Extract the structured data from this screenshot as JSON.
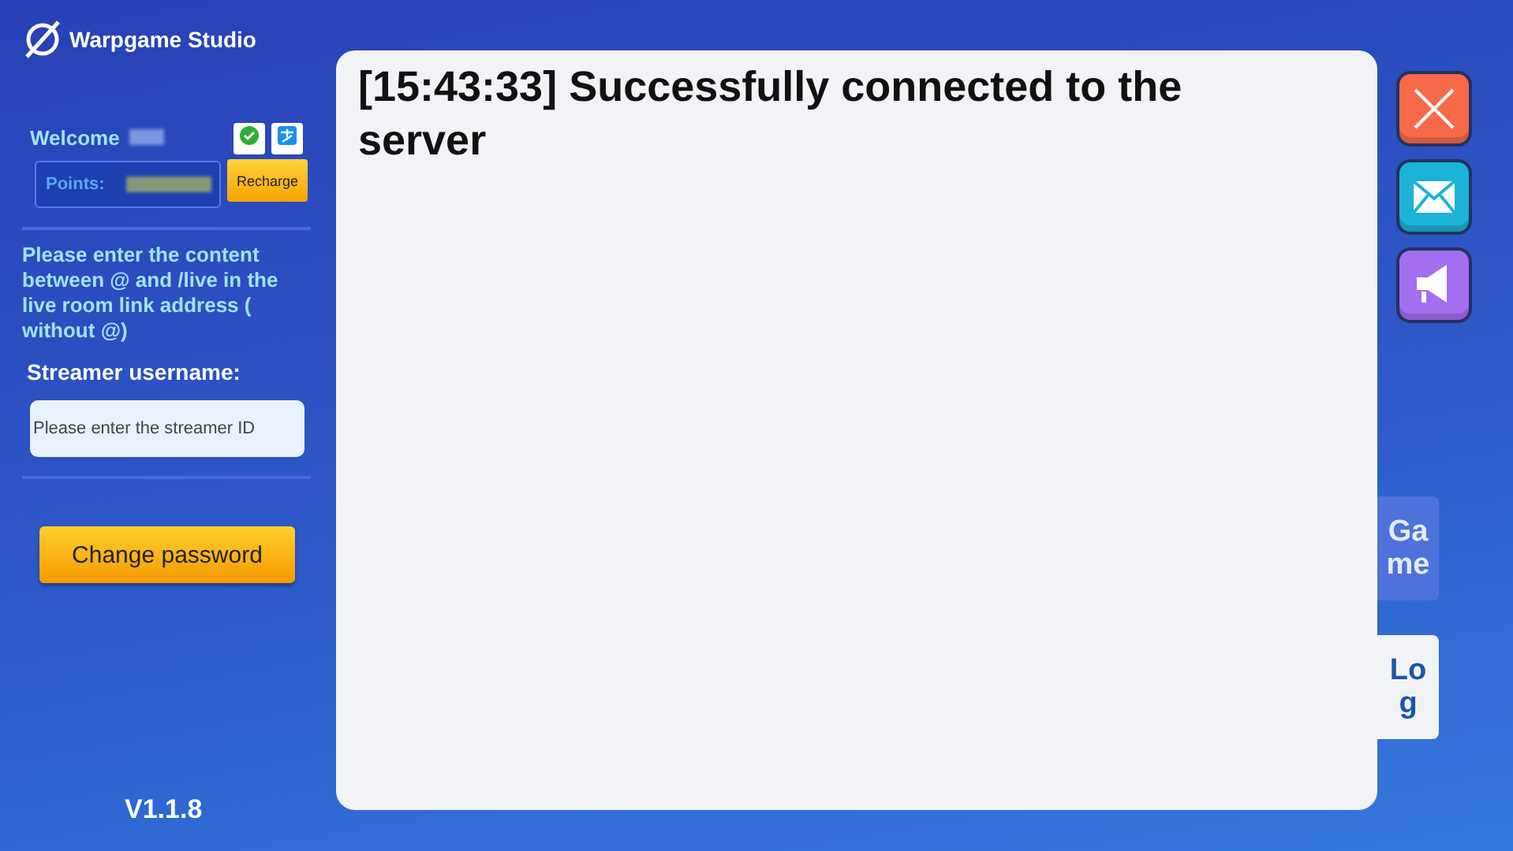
{
  "brand": {
    "name": "Warpgame Studio"
  },
  "account": {
    "welcome": "Welcome",
    "points_label": "Points:",
    "recharge": "Recharge"
  },
  "instructions": "Please enter the content between @ and /live in the live room link address ( without @)",
  "streamer": {
    "label": "Streamer username:",
    "placeholder": "Please enter the streamer ID"
  },
  "change_password": "Change password",
  "version": "V1.1.8",
  "log": {
    "lines": [
      "[15:43:33] Successfully connected to the server"
    ]
  },
  "tabs": [
    {
      "label": "Game",
      "selected": false
    },
    {
      "label": "Log",
      "selected": true
    }
  ]
}
